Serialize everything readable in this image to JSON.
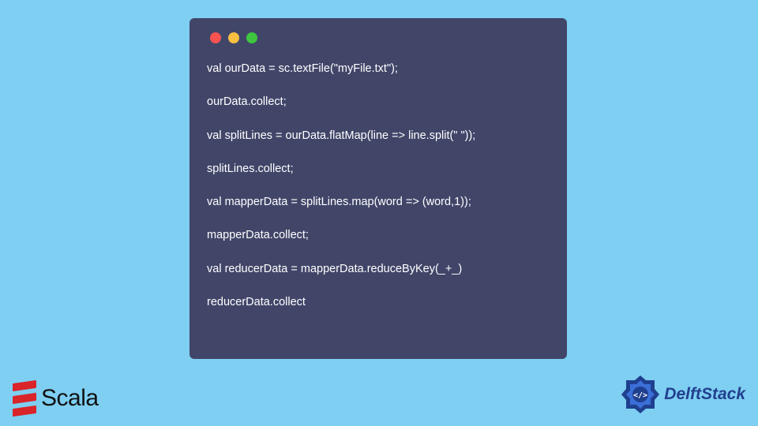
{
  "code": {
    "lines": [
      "val ourData = sc.textFile(\"myFile.txt\");",
      "ourData.collect;",
      "val splitLines = ourData.flatMap(line => line.split(\" \"));",
      "splitLines.collect;",
      "val mapperData = splitLines.map(word => (word,1));",
      "mapperData.collect;",
      "val reducerData = mapperData.reduceByKey(_+_)",
      "reducerData.collect"
    ]
  },
  "logos": {
    "scala_label": "Scala",
    "delft_label": "DelftStack"
  }
}
